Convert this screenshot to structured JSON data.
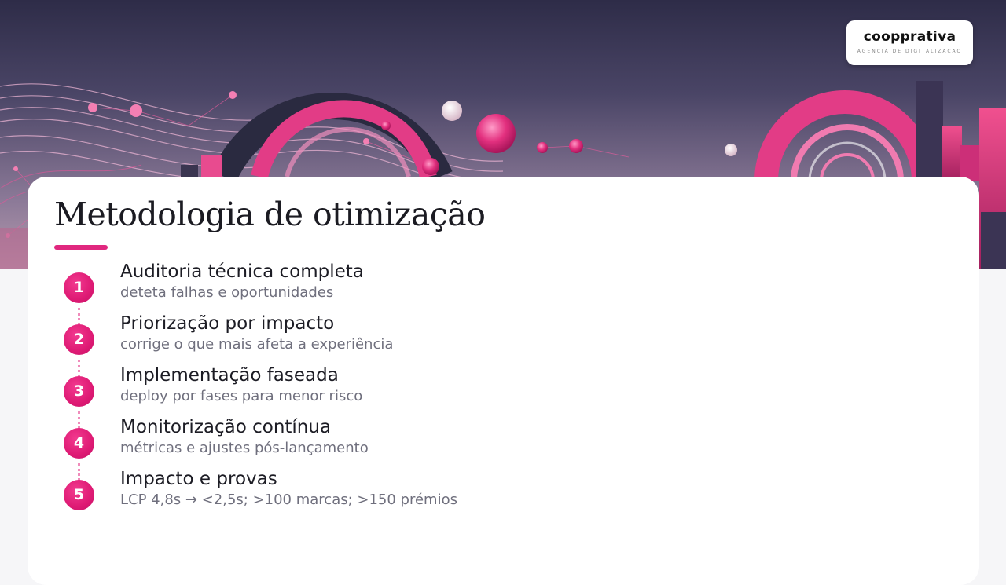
{
  "logo": {
    "name": "coopprativa",
    "tagline": "AGENCIA DE DIGITALIZACAO"
  },
  "slide": {
    "title": "Metodologia de otimização"
  },
  "steps": [
    {
      "number": "1",
      "title": "Auditoria técnica completa",
      "subtitle": "deteta falhas e oportunidades"
    },
    {
      "number": "2",
      "title": "Priorização por impacto",
      "subtitle": "corrige o que mais afeta a experiência"
    },
    {
      "number": "3",
      "title": "Implementação faseada",
      "subtitle": "deploy por fases para menor risco"
    },
    {
      "number": "4",
      "title": "Monitorização contínua",
      "subtitle": "métricas e ajustes pós-lançamento"
    },
    {
      "number": "5",
      "title": "Impacto e provas",
      "subtitle": "LCP 4,8s → <2,5s; >100 marcas; >150 prémios"
    }
  ],
  "colors": {
    "accent": "#e0287f",
    "hero_dark": "#2e2c48",
    "hero_light": "#b89aae"
  }
}
